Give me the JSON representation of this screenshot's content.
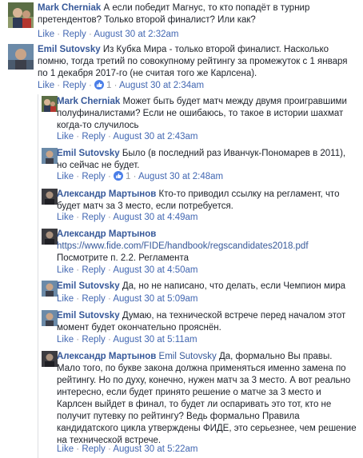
{
  "meta": {
    "like": "Like",
    "reply": "Reply",
    "sep": " · "
  },
  "comments": [
    {
      "author": "Mark Cherniak",
      "text": "А если победит Магнус, то кто попадёт в турнир претендентов? Только второй финалист? Или как?",
      "time": "August 30 at 2:32am"
    },
    {
      "author": "Emil Sutovsky",
      "text": "Из Кубка Мира - только второй финалист. Насколько помню, тогда третий по совокупному рейтингу за промежуток с 1 января по 1 декабря 2017-го (не считая того же Карлсена).",
      "likes": "1",
      "time": "August 30 at 2:34am"
    }
  ],
  "replies": [
    {
      "author": "Mark Cherniak",
      "text": "Может быть будет матч между двумя проигравшими полуфиналистами? Если не ошибаюсь, то такое в истории шахмат когда-то случилось",
      "time": "August 30 at 2:43am"
    },
    {
      "author": "Emil Sutovsky",
      "text": "Было (в последний раз Иванчук-Пономарев в 2011), но сейчас не будет.",
      "likes": "1",
      "time": "August 30 at 2:48am"
    },
    {
      "author": "Александр Мартынов",
      "text": "Кто-то приводил ссылку на регламент, что будет матч за 3 место, если потребуется.",
      "time": "August 30 at 4:49am"
    },
    {
      "author": "Александр Мартынов",
      "link": "https://www.fide.com/FIDE/handbook/regscandidates2018.pdf",
      "text": "Посмотрите п. 2.2. Регламента",
      "time": "August 30 at 4:50am"
    },
    {
      "author": "Emil Sutovsky",
      "text": "Да, но не написано, что делать, если Чемпион мира",
      "time": "August 30 at 5:09am"
    },
    {
      "author": "Emil Sutovsky",
      "text": "Думаю, на технической встрече перед началом этот момент будет окончательно прояснён.",
      "time": "August 30 at 5:11am"
    },
    {
      "author": "Александр Мартынов",
      "tag": "Emil Sutovsky",
      "text": "Да, формально Вы правы. Мало того, по букве закона должна применяться именно замена по рейтингу. Но по духу, конечно, нужен матч за 3 место. А вот реально интересно, если будет принято решение о матче за 3 место и Карлсен выйдет в финал, то будет ли оспаривать это тот, кто не получит путевку по рейтингу? Ведь формально Правила кандидатского цикла утверждены ФИДЕ, это серьезнее, чем решение на технической встрече.",
      "time": "August 30 at 5:22am"
    }
  ]
}
